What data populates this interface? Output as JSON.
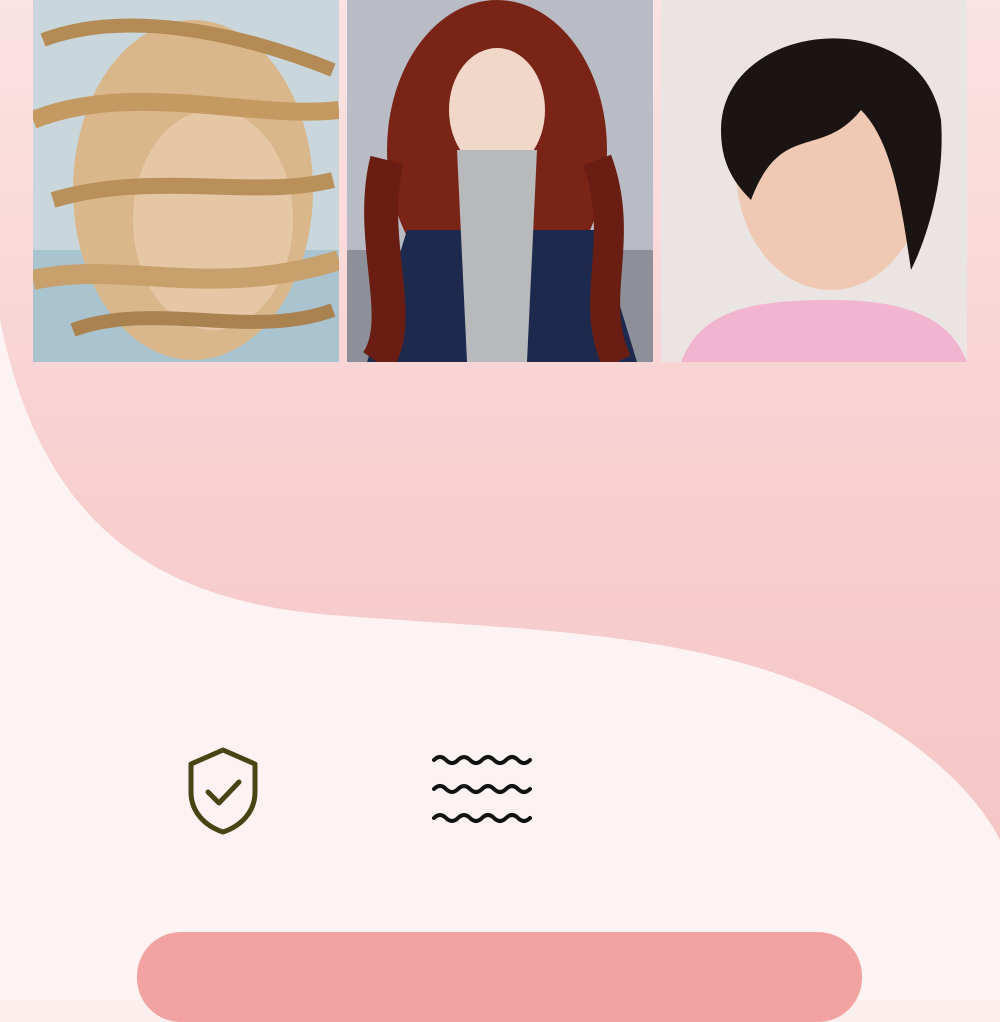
{
  "gallery": {
    "photos": [
      {
        "alt": "",
        "icon": "photo-windblown-blonde-hair"
      },
      {
        "alt": "",
        "icon": "photo-curly-red-hair"
      },
      {
        "alt": "",
        "icon": "photo-short-dark-hair"
      }
    ]
  },
  "features": {
    "shield": {
      "icon": "shield-check-icon"
    },
    "waves": {
      "icon": "wavy-lines-icon"
    }
  },
  "cta": {
    "label": ""
  },
  "colors": {
    "background": "#fdeeee",
    "pink_band": "#f9d3d3",
    "button": "#f2a3a1",
    "shield_stroke": "#4a4414",
    "wave_stroke": "#111111"
  }
}
